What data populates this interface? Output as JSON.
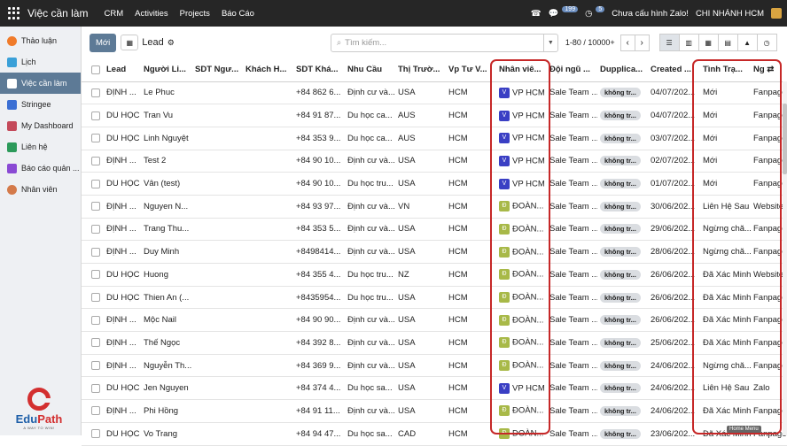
{
  "topbar": {
    "brand": "Việc cần làm",
    "menu": [
      "CRM",
      "Activities",
      "Projects",
      "Báo Cáo"
    ],
    "chat_count": "199",
    "activity_count": "5",
    "zalo_status": "Chưa cấu hình Zalo!",
    "branch": "CHI NHÁNH HCM"
  },
  "sidebar": {
    "items": [
      {
        "label": "Thảo luận",
        "color": "#f07b2a"
      },
      {
        "label": "Lịch",
        "color": "#3aa0d8"
      },
      {
        "label": "Việc cần làm",
        "color": "#5d7a96"
      },
      {
        "label": "Stringee",
        "color": "#3b6fd4"
      },
      {
        "label": "My Dashboard",
        "color": "#c44a5a"
      },
      {
        "label": "Liên hệ",
        "color": "#2c9a5a"
      },
      {
        "label": "Báo cáo quản ...",
        "color": "#8a4ad4"
      },
      {
        "label": "Nhân viên",
        "color": "#d47a4a"
      }
    ],
    "logo_name_1": "Edu",
    "logo_name_2": "Path",
    "logo_tag": "A WAY TO WIN!"
  },
  "toolbar": {
    "new_label": "Mới",
    "view_title": "Lead",
    "search_placeholder": "Tìm kiếm...",
    "pager": "1-80 / 10000+"
  },
  "colors": {
    "vp": "#3a3fc4",
    "doan": "#a8b948"
  },
  "table": {
    "headers": [
      "Lead",
      "Người Li...",
      "SDT Ngư...",
      "Khách H...",
      "SDT Khá...",
      "Nhu Cầu",
      "Thị Trườ...",
      "Vp Tư V...",
      "Nhân viê...",
      "Đội ngũ ...",
      "Dupplica...",
      "Created ...",
      "Tình Trạ...",
      "Ng"
    ],
    "rows": [
      [
        "ĐỊNH ...",
        "Le Phuc",
        "",
        "",
        "+84 862 6...",
        "Định cư và...",
        "USA",
        "HCM",
        "V",
        "VP HCM",
        "Sale Team ...",
        "không tr...",
        "04/07/202...",
        "Mới",
        "Fanpage"
      ],
      [
        "DU HỌC",
        "Tran Vu",
        "",
        "",
        "+84 91 87...",
        "Du học ca...",
        "AUS",
        "HCM",
        "V",
        "VP HCM",
        "Sale Team ...",
        "không tr...",
        "04/07/202...",
        "Mới",
        "Fanpage"
      ],
      [
        "DU HỌC",
        "Linh Nguyệt",
        "",
        "",
        "+84 353 9...",
        "Du học ca...",
        "AUS",
        "HCM",
        "V",
        "VP HCM",
        "Sale Team ...",
        "không tr...",
        "03/07/202...",
        "Mới",
        "Fanpage"
      ],
      [
        "ĐỊNH ...",
        "Test 2",
        "",
        "",
        "+84 90 10...",
        "Định cư và...",
        "USA",
        "HCM",
        "V",
        "VP HCM",
        "Sale Team ...",
        "không tr...",
        "02/07/202...",
        "Mới",
        "Fanpage"
      ],
      [
        "DU HỌC",
        "Vân (test)",
        "",
        "",
        "+84 90 10...",
        "Du học tru...",
        "USA",
        "HCM",
        "V",
        "VP HCM",
        "Sale Team ...",
        "không tr...",
        "01/07/202...",
        "Mới",
        "Fanpage"
      ],
      [
        "ĐỊNH ...",
        "Nguyen N...",
        "",
        "",
        "+84 93 97...",
        "Định cư và...",
        "VN",
        "HCM",
        "Đ",
        "ĐOÀN...",
        "Sale Team ...",
        "không tr...",
        "30/06/202...",
        "Liên Hệ Sau",
        "Website"
      ],
      [
        "ĐỊNH ...",
        "Trang Thu...",
        "",
        "",
        "+84 353 5...",
        "Định cư và...",
        "USA",
        "HCM",
        "Đ",
        "ĐOÀN...",
        "Sale Team ...",
        "không tr...",
        "29/06/202...",
        "Ngừng chă...",
        "Fanpage"
      ],
      [
        "ĐỊNH ...",
        "Duy Minh",
        "",
        "",
        "+8498414...",
        "Định cư và...",
        "USA",
        "HCM",
        "Đ",
        "ĐOÀN...",
        "Sale Team ...",
        "không tr...",
        "28/06/202...",
        "Ngừng chă...",
        "Fanpage"
      ],
      [
        "DU HỌC",
        "Huong",
        "",
        "",
        "+84 355 4...",
        "Du học tru...",
        "NZ",
        "HCM",
        "Đ",
        "ĐOÀN...",
        "Sale Team ...",
        "không tr...",
        "26/06/202...",
        "Đã Xác Minh",
        "Website"
      ],
      [
        "DU HỌC",
        "Thien An (...",
        "",
        "",
        "+8435954...",
        "Du học tru...",
        "USA",
        "HCM",
        "Đ",
        "ĐOÀN...",
        "Sale Team ...",
        "không tr...",
        "26/06/202...",
        "Đã Xác Minh",
        "Fanpage"
      ],
      [
        "ĐỊNH ...",
        "Mộc Nail",
        "",
        "",
        "+84 90 90...",
        "Định cư và...",
        "USA",
        "HCM",
        "Đ",
        "ĐOÀN...",
        "Sale Team ...",
        "không tr...",
        "26/06/202...",
        "Đã Xác Minh",
        "Fanpage"
      ],
      [
        "ĐỊNH ...",
        "Thế Ngọc",
        "",
        "",
        "+84 392 8...",
        "Định cư và...",
        "USA",
        "HCM",
        "Đ",
        "ĐOÀN...",
        "Sale Team ...",
        "không tr...",
        "25/06/202...",
        "Đã Xác Minh",
        "Fanpage"
      ],
      [
        "ĐỊNH ...",
        "Nguyễn Th...",
        "",
        "",
        "+84 369 9...",
        "Định cư và...",
        "USA",
        "HCM",
        "Đ",
        "ĐOÀN...",
        "Sale Team ...",
        "không tr...",
        "24/06/202...",
        "Ngừng chă...",
        "Fanpage"
      ],
      [
        "DU HỌC",
        "Jen Nguyen",
        "",
        "",
        "+84 374 4...",
        "Du học sa...",
        "USA",
        "HCM",
        "V",
        "VP HCM",
        "Sale Team ...",
        "không tr...",
        "24/06/202...",
        "Liên Hệ Sau",
        "Zalo"
      ],
      [
        "ĐỊNH ...",
        "Phi Hồng",
        "",
        "",
        "+84 91 11...",
        "Định cư và...",
        "USA",
        "HCM",
        "Đ",
        "ĐOÀN...",
        "Sale Team ...",
        "không tr...",
        "24/06/202...",
        "Đã Xác Minh",
        "Fanpage"
      ],
      [
        "DU HỌC",
        "Vo Trang",
        "",
        "",
        "+84 94 47...",
        "Du học sa...",
        "CAD",
        "HCM",
        "Đ",
        "ĐOÀN...",
        "Sale Team ...",
        "không tr...",
        "23/06/202...",
        "Đã Xác Minh",
        "Fanpage"
      ]
    ]
  },
  "tooltip": "Home Menu"
}
